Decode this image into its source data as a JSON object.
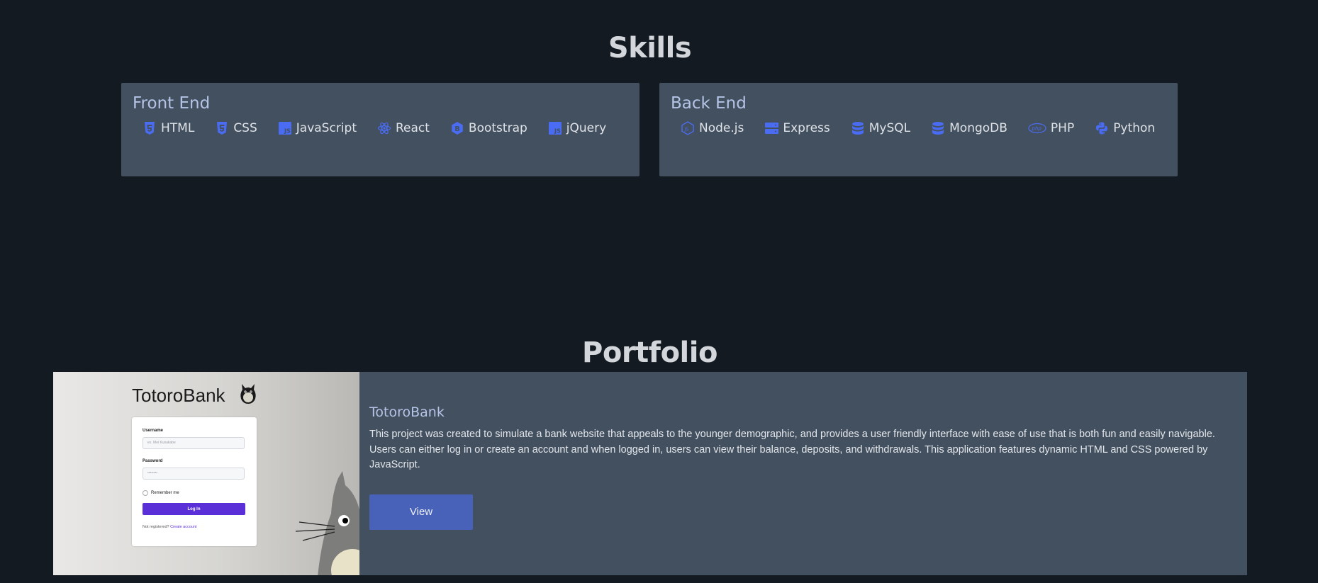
{
  "skills": {
    "title": "Skills",
    "frontend": {
      "title": "Front End",
      "items": [
        {
          "label": "HTML",
          "icon": "html5-icon"
        },
        {
          "label": "CSS",
          "icon": "css3-icon"
        },
        {
          "label": "JavaScript",
          "icon": "javascript-icon"
        },
        {
          "label": "React",
          "icon": "react-icon"
        },
        {
          "label": "Bootstrap",
          "icon": "bootstrap-icon"
        },
        {
          "label": "jQuery",
          "icon": "jquery-js-icon"
        }
      ]
    },
    "backend": {
      "title": "Back End",
      "items": [
        {
          "label": "Node.js",
          "icon": "nodejs-icon"
        },
        {
          "label": "Express",
          "icon": "server-icon"
        },
        {
          "label": "MySQL",
          "icon": "database-icon"
        },
        {
          "label": "MongoDB",
          "icon": "database-icon"
        },
        {
          "label": "PHP",
          "icon": "php-icon"
        },
        {
          "label": "Python",
          "icon": "python-icon"
        }
      ]
    }
  },
  "portfolio": {
    "title": "Portfolio",
    "project": {
      "title": "TotoroBank",
      "description": "This project was created to simulate a bank website that appeals to the younger demographic, and provides a user friendly interface with ease of use that is both fun and easily navigable. Users can either log in or create an account and when logged in, users can view their balance, deposits, and withdrawals. This application features dynamic HTML and CSS powered by JavaScript.",
      "view_label": "View",
      "screenshot": {
        "logo": "TotoroBank",
        "username_label": "Username",
        "username_placeholder": "ex. Mei Kusakabe",
        "password_label": "Password",
        "password_placeholder": "••••••••",
        "remember_label": "Remember me",
        "login_label": "Log In",
        "footer_text": "Not registered?",
        "footer_link": "Create account"
      }
    }
  },
  "colors": {
    "background": "#141a21",
    "card": "#435060",
    "accent": "#4762b8",
    "icon": "#4a6cf2"
  }
}
